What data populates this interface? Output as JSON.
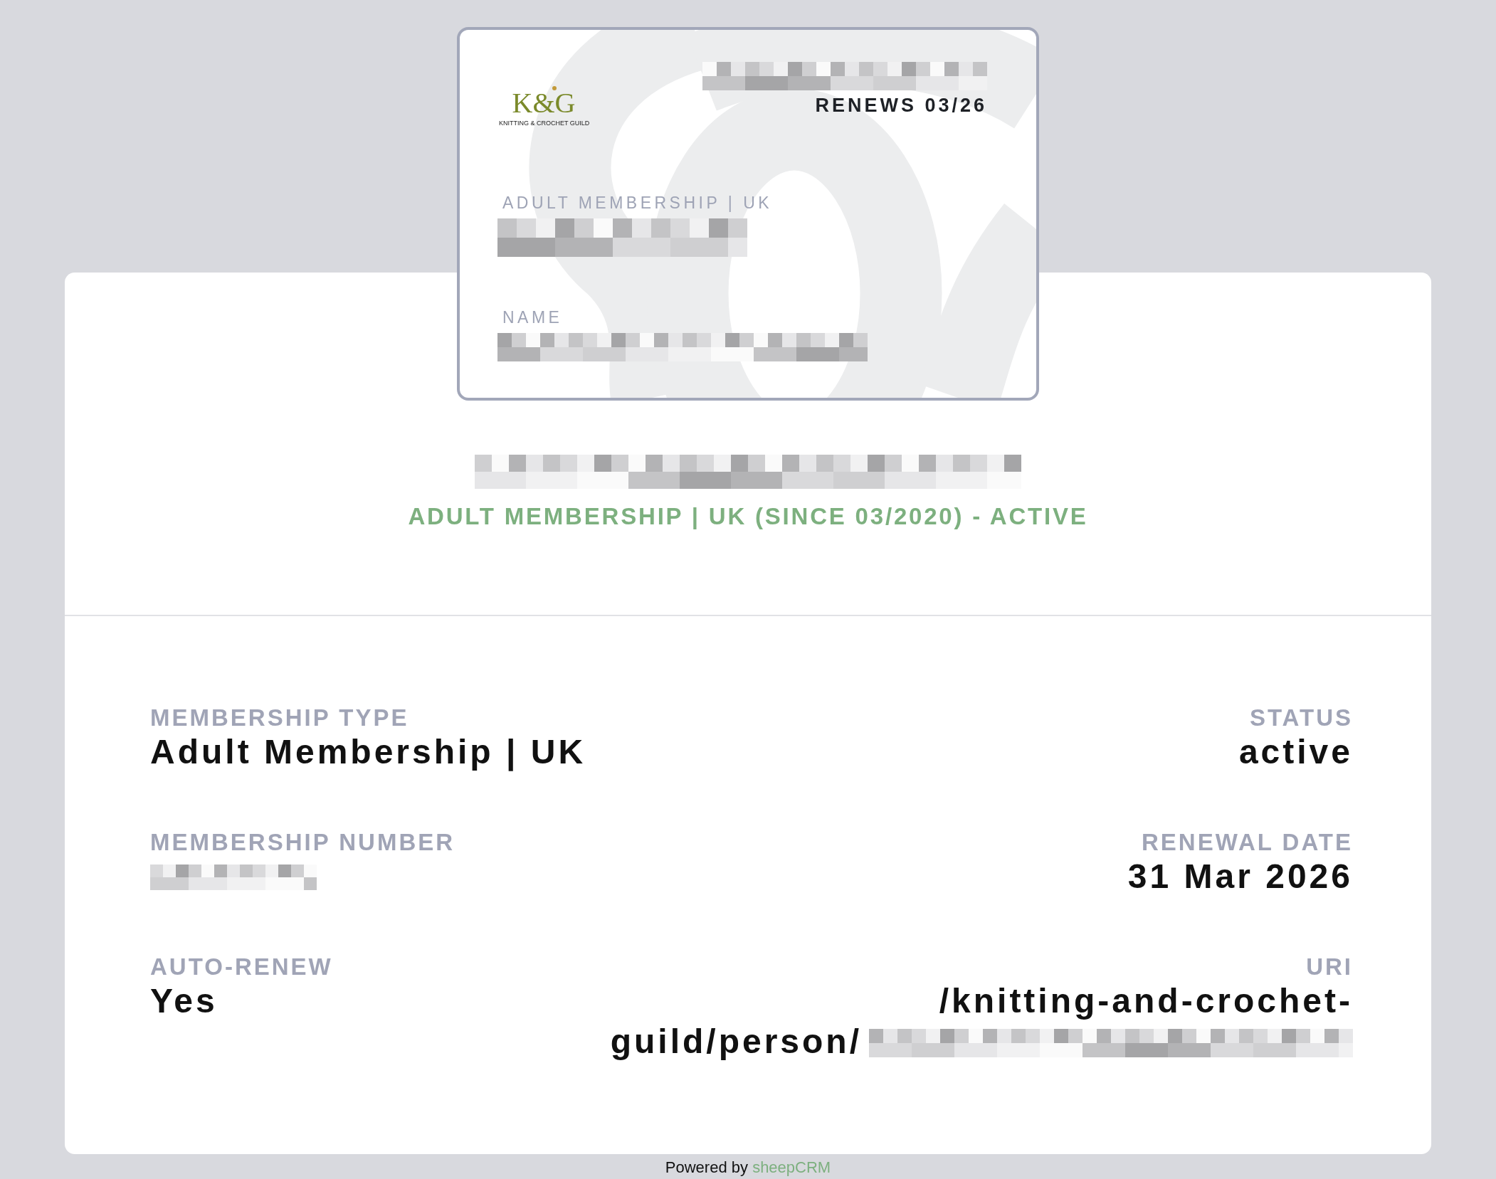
{
  "card": {
    "logo": {
      "mark": "K&G",
      "tagline": "KNITTING & CROCHET GUILD"
    },
    "header_redacted": true,
    "renews": "RENEWS 03/26",
    "type_label": "ADULT MEMBERSHIP | UK",
    "number_redacted": true,
    "name_label": "NAME",
    "name_redacted": true
  },
  "profile": {
    "name_redacted": true,
    "summary": "ADULT MEMBERSHIP | UK (SINCE 03/2020) - ACTIVE"
  },
  "details": [
    {
      "label": "MEMBERSHIP TYPE",
      "value": "Adult Membership | UK"
    },
    {
      "label": "STATUS",
      "value": "active"
    },
    {
      "label": "MEMBERSHIP NUMBER",
      "redacted": true
    },
    {
      "label": "RENEWAL DATE",
      "value": "31 Mar 2026"
    },
    {
      "label": "AUTO-RENEW",
      "value": "Yes"
    },
    {
      "label": "URI",
      "value": "/knitting-and-crochet-guild/person/",
      "redacted": true
    }
  ],
  "footer": {
    "text": "Powered by",
    "link": "sheepCRM"
  }
}
